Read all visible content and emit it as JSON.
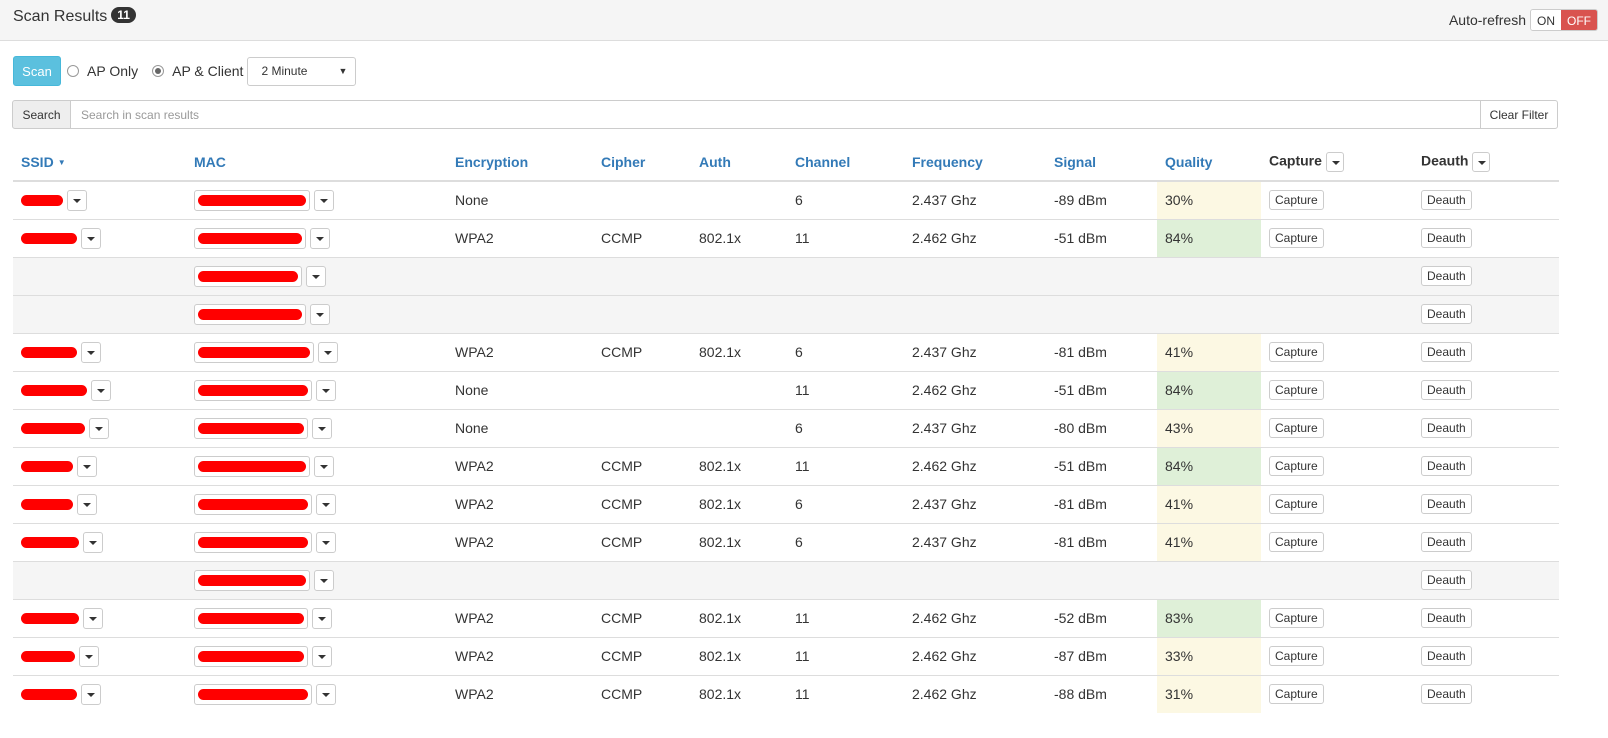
{
  "header": {
    "title": "Scan Results",
    "count": "11",
    "autorefresh_label": "Auto-refresh",
    "toggle_on": "ON",
    "toggle_off": "OFF",
    "toggle_state": "off",
    "toggle_off_color": "#d9534f"
  },
  "controls": {
    "scan_label": "Scan",
    "scan_color": "#5bc0de",
    "mode_options": [
      {
        "label": "AP Only",
        "checked": false
      },
      {
        "label": "AP & Client",
        "checked": true
      }
    ],
    "interval_selected": "2 Minute"
  },
  "search": {
    "addon_label": "Search",
    "placeholder": "Search in scan results",
    "value": "",
    "clear_label": "Clear Filter"
  },
  "table": {
    "columns": {
      "ssid": "SSID",
      "mac": "MAC",
      "encryption": "Encryption",
      "cipher": "Cipher",
      "auth": "Auth",
      "channel": "Channel",
      "frequency": "Frequency",
      "signal": "Signal",
      "quality": "Quality",
      "capture": "Capture",
      "deauth": "Deauth"
    },
    "capture_label": "Capture",
    "deauth_label": "Deauth",
    "quality_colors": {
      "low": "#fcf8e3",
      "high": "#dff0d8"
    },
    "rows": [
      {
        "type": "ap",
        "encryption": "None",
        "cipher": "",
        "auth": "",
        "channel": "6",
        "frequency": "2.437 Ghz",
        "signal": "-89 dBm",
        "quality": "30%",
        "level": "low"
      },
      {
        "type": "ap",
        "encryption": "WPA2",
        "cipher": "CCMP",
        "auth": "802.1x",
        "channel": "11",
        "frequency": "2.462 Ghz",
        "signal": "-51 dBm",
        "quality": "84%",
        "level": "high"
      },
      {
        "type": "client"
      },
      {
        "type": "client"
      },
      {
        "type": "ap",
        "encryption": "WPA2",
        "cipher": "CCMP",
        "auth": "802.1x",
        "channel": "6",
        "frequency": "2.437 Ghz",
        "signal": "-81 dBm",
        "quality": "41%",
        "level": "low"
      },
      {
        "type": "ap",
        "encryption": "None",
        "cipher": "",
        "auth": "",
        "channel": "11",
        "frequency": "2.462 Ghz",
        "signal": "-51 dBm",
        "quality": "84%",
        "level": "high"
      },
      {
        "type": "ap",
        "encryption": "None",
        "cipher": "",
        "auth": "",
        "channel": "6",
        "frequency": "2.437 Ghz",
        "signal": "-80 dBm",
        "quality": "43%",
        "level": "low"
      },
      {
        "type": "ap",
        "encryption": "WPA2",
        "cipher": "CCMP",
        "auth": "802.1x",
        "channel": "11",
        "frequency": "2.462 Ghz",
        "signal": "-51 dBm",
        "quality": "84%",
        "level": "high"
      },
      {
        "type": "ap",
        "encryption": "WPA2",
        "cipher": "CCMP",
        "auth": "802.1x",
        "channel": "6",
        "frequency": "2.437 Ghz",
        "signal": "-81 dBm",
        "quality": "41%",
        "level": "low"
      },
      {
        "type": "ap",
        "encryption": "WPA2",
        "cipher": "CCMP",
        "auth": "802.1x",
        "channel": "6",
        "frequency": "2.437 Ghz",
        "signal": "-81 dBm",
        "quality": "41%",
        "level": "low"
      },
      {
        "type": "client"
      },
      {
        "type": "ap",
        "encryption": "WPA2",
        "cipher": "CCMP",
        "auth": "802.1x",
        "channel": "11",
        "frequency": "2.462 Ghz",
        "signal": "-52 dBm",
        "quality": "83%",
        "level": "high"
      },
      {
        "type": "ap",
        "encryption": "WPA2",
        "cipher": "CCMP",
        "auth": "802.1x",
        "channel": "11",
        "frequency": "2.462 Ghz",
        "signal": "-87 dBm",
        "quality": "33%",
        "level": "low"
      },
      {
        "type": "ap",
        "encryption": "WPA2",
        "cipher": "CCMP",
        "auth": "802.1x",
        "channel": "11",
        "frequency": "2.462 Ghz",
        "signal": "-88 dBm",
        "quality": "31%",
        "level": "low"
      }
    ]
  }
}
